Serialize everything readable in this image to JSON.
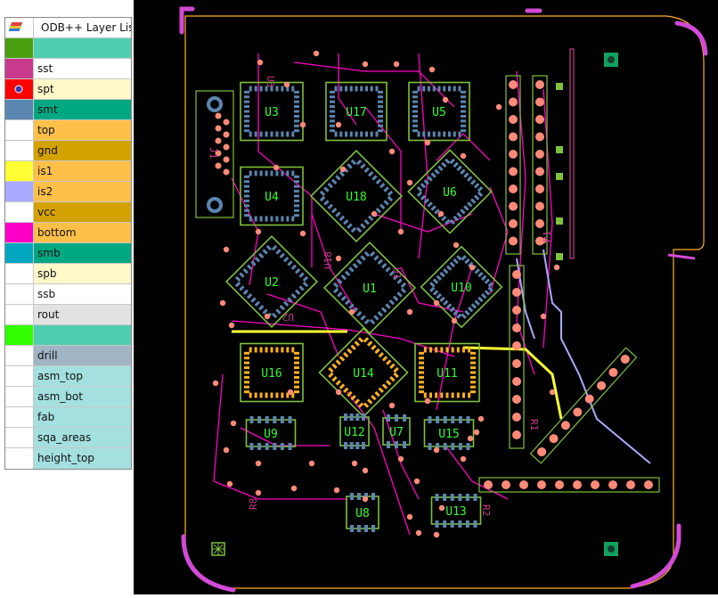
{
  "layer_panel": {
    "title": "ODB++ Layer List",
    "layers": [
      {
        "name": "",
        "swatch": "#4aa10f",
        "bg": "#4fcfb0",
        "wave": true
      },
      {
        "name": "sst",
        "swatch": "#c93a8c",
        "bg": "#ffffff"
      },
      {
        "name": "spt",
        "swatch": "#ff0000",
        "bg": "#fff8c8",
        "active": true
      },
      {
        "name": "smt",
        "swatch": "#5a86b0",
        "bg": "#00a881"
      },
      {
        "name": "top",
        "swatch": "#ffffff",
        "bg": "#ffc04a"
      },
      {
        "name": "gnd",
        "swatch": "#ffffff",
        "bg": "#d4a200"
      },
      {
        "name": "is1",
        "swatch": "#ffff33",
        "bg": "#ffc04a"
      },
      {
        "name": "is2",
        "swatch": "#a9a9ff",
        "bg": "#ffc04a"
      },
      {
        "name": "vcc",
        "swatch": "#ffffff",
        "bg": "#d4a200"
      },
      {
        "name": "bottom",
        "swatch": "#ff00c8",
        "bg": "#ffc04a"
      },
      {
        "name": "smb",
        "swatch": "#00a6c0",
        "bg": "#00a881"
      },
      {
        "name": "spb",
        "swatch": "#ffffff",
        "bg": "#fff8c8"
      },
      {
        "name": "ssb",
        "swatch": "#ffffff",
        "bg": "#ffffff"
      },
      {
        "name": "rout",
        "swatch": "#ffffff",
        "bg": "#e2e2e2"
      },
      {
        "name": "",
        "swatch": "#33ff00",
        "bg": "#4fcfb0",
        "wave": true
      },
      {
        "name": "drill",
        "swatch": "#ffffff",
        "bg": "#a0b4c4"
      },
      {
        "name": "asm_top",
        "swatch": "#ffffff",
        "bg": "#a4e0e0"
      },
      {
        "name": "asm_bot",
        "swatch": "#ffffff",
        "bg": "#a4e0e0"
      },
      {
        "name": "fab",
        "swatch": "#ffffff",
        "bg": "#a4e0e0"
      },
      {
        "name": "sqa_areas",
        "swatch": "#ffffff",
        "bg": "#a4e0e0"
      },
      {
        "name": "height_top",
        "swatch": "#ffffff",
        "bg": "#a4e0e0"
      }
    ]
  },
  "board": {
    "components": [
      {
        "ref": "U3",
        "type": "qfp"
      },
      {
        "ref": "U17",
        "type": "qfp"
      },
      {
        "ref": "U5",
        "type": "qfp"
      },
      {
        "ref": "U4",
        "type": "qfp"
      },
      {
        "ref": "U18",
        "type": "qfp-rot"
      },
      {
        "ref": "U6",
        "type": "qfp-rot"
      },
      {
        "ref": "U2",
        "type": "qfp-rot"
      },
      {
        "ref": "U1",
        "type": "qfp-rot"
      },
      {
        "ref": "U10",
        "type": "qfp-rot"
      },
      {
        "ref": "U16",
        "type": "qfp"
      },
      {
        "ref": "U14",
        "type": "qfp-rot"
      },
      {
        "ref": "U11",
        "type": "qfp"
      },
      {
        "ref": "U9",
        "type": "soic"
      },
      {
        "ref": "U12",
        "type": "soic"
      },
      {
        "ref": "U7",
        "type": "soic"
      },
      {
        "ref": "U15",
        "type": "soic"
      },
      {
        "ref": "U8",
        "type": "soic"
      },
      {
        "ref": "U13",
        "type": "soic"
      }
    ],
    "silk_refs": [
      "U3",
      "U18",
      "U1",
      "U2",
      "P1",
      "R1",
      "R2",
      "R8",
      "J1"
    ],
    "colors": {
      "outline": "#ffb020",
      "bottom_trace": "#ff00c8",
      "silk": "#c93a8c",
      "component": "#7ec13a",
      "pad_top": "#ffb020",
      "pad_mask": "#5a86b0",
      "drill_pad": "#ff8a78",
      "label": "#33ff33"
    }
  }
}
